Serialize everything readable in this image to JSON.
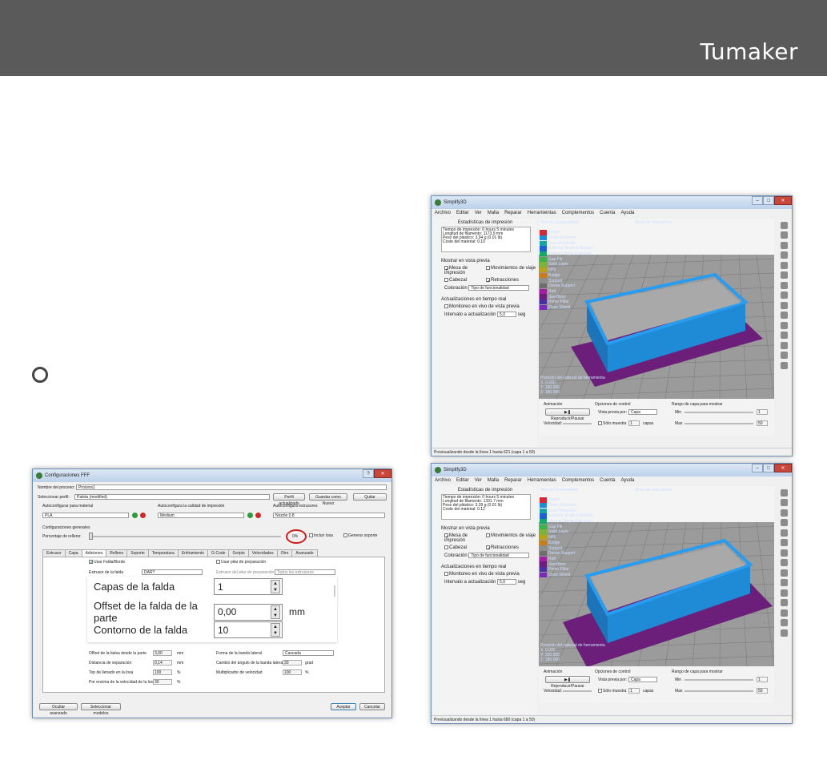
{
  "brand": {
    "logo": "Tumaker"
  },
  "settings_window": {
    "title": "Configuraciones FFF",
    "process_label": "Nombre del proceso:",
    "process_value": "Process1",
    "profile_label": "Seleccionar perfil:",
    "profile_value": "Paleta (modified)",
    "profile_buttons": [
      "Perfil actualizado",
      "Guardar como Nuevo",
      "Quitar"
    ],
    "material_label": "Autoconfigurar para material",
    "material_value": "PLA",
    "quality_label": "Autoconfigura la calidad de impresión",
    "quality_value": "Medium",
    "extruder_label": "Autoconfigura extrusores",
    "extruder_value": "Nozzle 0.8",
    "general_label": "Configuraciones generales",
    "infill_label": "Porcentaje de relleno:",
    "infill_value": "0%",
    "raft_label": "Incluir losa",
    "support_label": "Generar soporte",
    "tabs": [
      "Extrusor",
      "Capa",
      "Adiciones",
      "Relleno",
      "Soporte",
      "Temperatura",
      "Enfriamiento",
      "G-Code",
      "Scripts",
      "Velocidades",
      "Otro",
      "Avanzado"
    ],
    "active_tab": 2,
    "skirt_check": "Usar Falda/Borde",
    "skirt_extruder_label": "Extrusor de la falda",
    "skirt_extruder_value": "DART",
    "prime_check": "Usar pilar de preparación",
    "prime_extruder_label": "Extrusor del pilar de preparación",
    "prime_extruder_value": "Todos los extrusores",
    "zoom_rows": [
      {
        "label": "Capas de la falda",
        "value": "1",
        "unit": ""
      },
      {
        "label": "Offset de la falda de la parte",
        "value": "0,00",
        "unit": "mm"
      },
      {
        "label": "Contorno de la falda",
        "value": "10",
        "unit": ""
      }
    ],
    "left_rows": [
      {
        "label": "Offset de la balsa desde la parte",
        "value": "3,00",
        "unit": "mm"
      },
      {
        "label": "Distancia de separación",
        "value": "0,14",
        "unit": "mm"
      },
      {
        "label": "Top de llenado en la losa",
        "value": "100",
        "unit": "%"
      },
      {
        "label": "Por encima de la velocidad de la losa",
        "value": "30",
        "unit": "%"
      }
    ],
    "right_rows": [
      {
        "label": "Forma de la banda lateral",
        "value": "Cascada",
        "unit": ""
      },
      {
        "label": "Cambio del ángulo de la banda lateral",
        "value": "30",
        "unit": "grad"
      },
      {
        "label": "Multiplicador de velocidad",
        "value": "100",
        "unit": "%"
      }
    ],
    "footer_left": [
      "Ocultar avanzado",
      "Seleccionar modelos"
    ],
    "footer_right": [
      "Aceptar",
      "Cancelar"
    ]
  },
  "s3d_windows": [
    {
      "title": "Simplify3D",
      "menu": [
        "Archivo",
        "Editar",
        "Ver",
        "Malla",
        "Reparar",
        "Herramientas",
        "Complementos",
        "Cuenta",
        "Ayuda"
      ],
      "stats_title": "Estadísticas de impresión",
      "stats": [
        "Tiempo de impresión: 0 hours 5 minutes",
        "Longitud de filamento: 1173.9 mm",
        "Peso del plástico: 3.94 g (0.01 lb)",
        "Coste del material: 0.10"
      ],
      "preview_title": "Mostrar en vista previa",
      "preview_options": [
        "Mesa de impresión",
        "Movimientos de viaje",
        "Cabezal",
        "Retracciones"
      ],
      "coloring_label": "Coloración",
      "coloring_value": "Tipo de funcionalidad",
      "realtime_title": "Actualizaciones en tiempo real",
      "realtime_check": "Monitoreo en vivo de vista previa",
      "interval_label": "Intervalo a actualización",
      "interval_value": "5,0",
      "interval_unit": "seg",
      "legend_title": "Tipo de funcionalidad",
      "mode_title": "Modo de vista previa",
      "head_title": "Posición del cabezal de herramienta",
      "head_coords": [
        "X: 0.000",
        "Y: 190.000",
        "Z: 180.000"
      ],
      "anim_label": "Animación",
      "play_label": "Reproducir/Pausar",
      "speed_label": "Velocidad:",
      "control_label": "Opciones de control",
      "preview_by_label": "Vista previa por:",
      "preview_by_value": "Capa",
      "single_label": "Sólo muestra",
      "single_value": "1",
      "layers_label": "capas",
      "range_label": "Rango de capa para mostrar",
      "min_label": "Min",
      "min_value": "1",
      "max_label": "Max",
      "max_value": "50",
      "status": "Previsualizando desde la línea 1 hasta 621 (capa 1 a 50)"
    },
    {
      "title": "Simplify3D",
      "menu": [
        "Archivo",
        "Editar",
        "Ver",
        "Malla",
        "Reparar",
        "Herramientas",
        "Complementos",
        "Cuenta",
        "Ayuda"
      ],
      "stats_title": "Estadísticas de impresión",
      "stats": [
        "Tiempo de impresión: 0 hours 5 minutes",
        "Longitud de filamento: 1331.7 mm",
        "Peso del plástico: 3.39 g (0.01 lb)",
        "Coste del material: 0.12"
      ],
      "preview_title": "Mostrar en vista previa",
      "preview_options": [
        "Mesa de impresión",
        "Movimientos de viaje",
        "Cabezal",
        "Retracciones"
      ],
      "coloring_label": "Coloración",
      "coloring_value": "Tipo de funcionalidad",
      "realtime_title": "Actualizaciones en tiempo real",
      "realtime_check": "Monitoreo en vivo de vista previa",
      "interval_label": "Intervalo a actualización",
      "interval_value": "5,0",
      "interval_unit": "seg",
      "legend_title": "Tipo de funcionalidad",
      "mode_title": "Modo de vista previa",
      "head_title": "Posición del cabezal de herramienta",
      "head_coords": [
        "X: 0.000",
        "Y: 190.000",
        "Z: 180.000"
      ],
      "anim_label": "Animación",
      "play_label": "Reproducir/Pausar",
      "speed_label": "Velocidad:",
      "control_label": "Opciones de control",
      "preview_by_label": "Vista previa por:",
      "preview_by_value": "Capa",
      "single_label": "Sólo muestra",
      "single_value": "1",
      "layers_label": "capas",
      "range_label": "Rango de capa para mostrar",
      "min_label": "Min",
      "min_value": "1",
      "max_label": "Max",
      "max_value": "50",
      "status": "Previsualizando desde la línea 1 hasta 680 (capa 1 a 50)"
    }
  ],
  "legend_items": [
    {
      "name": "Travel",
      "color": "#d02a3a"
    },
    {
      "name": "Outer Perimeter",
      "color": "#1f8ad6"
    },
    {
      "name": "Inner Perimeter",
      "color": "#1aa3a3"
    },
    {
      "name": "External Single Extrusion",
      "color": "#1f5fcf"
    },
    {
      "name": "Internal Single Extrusion",
      "color": "#19a66b"
    },
    {
      "name": "Gap Fill",
      "color": "#3fb14a"
    },
    {
      "name": "Solid Layer",
      "color": "#7fb23a"
    },
    {
      "name": "Infill",
      "color": "#b8a21c"
    },
    {
      "name": "Bridge",
      "color": "#c97d1a"
    },
    {
      "name": "Support",
      "color": "#8d8d8d"
    },
    {
      "name": "Dense Support",
      "color": "#6e6e6e"
    },
    {
      "name": "Raft",
      "color": "#a21fa0"
    },
    {
      "name": "Skirt/Brim",
      "color": "#6b1f7a"
    },
    {
      "name": "Prime Pillar",
      "color": "#4a2fa0"
    },
    {
      "name": "Ooze Shield",
      "color": "#7a2ab8"
    }
  ],
  "colors": {
    "header": "#5a5a5a",
    "part": "#1f8ad6",
    "brim": "#6b1f7a",
    "bed": "#9b9b9b",
    "highlight": "#cc1f1f"
  }
}
